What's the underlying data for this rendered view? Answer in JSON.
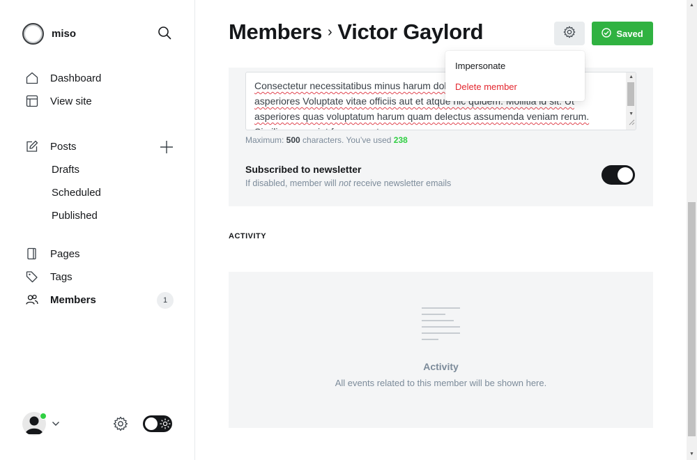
{
  "brand": {
    "name": "miso",
    "logo_icon": "ring-logo"
  },
  "sidebar": {
    "nav": [
      {
        "label": "Dashboard",
        "icon": "home-icon"
      },
      {
        "label": "View site",
        "icon": "layout-icon"
      }
    ],
    "posts": {
      "label": "Posts",
      "icon": "edit-icon",
      "sub": [
        "Drafts",
        "Scheduled",
        "Published"
      ]
    },
    "lower_nav": [
      {
        "label": "Pages",
        "icon": "page-icon"
      },
      {
        "label": "Tags",
        "icon": "tag-icon"
      },
      {
        "label": "Members",
        "icon": "members-icon",
        "badge": "1",
        "active": true
      }
    ],
    "theme_toggle": {
      "dark_mode": true
    }
  },
  "header": {
    "breadcrumb_parent": "Members",
    "breadcrumb_separator": "›",
    "member_name": "Victor Gaylord",
    "save_label": "Saved",
    "colors": {
      "saved": "#30b241"
    }
  },
  "dropdown": {
    "impersonate": "Impersonate",
    "delete": "Delete member",
    "colors": {
      "delete": "#e3252d"
    }
  },
  "form": {
    "note_text": "Consectetur necessitatibus minus harum dolorum quidem. Mollitia id sit. Ut asperiores Voluptate vitae officiis aut et atque hic quidem. Mollitia id sit. Ut asperiores quas voluptatum harum quam delectus assumenda veniam rerum. Similique eveniet facere sunt.",
    "hint_prefix": "Maximum: ",
    "hint_max": "500",
    "hint_middle": " characters. You’ve used ",
    "hint_used": "238",
    "newsletter_title": "Subscribed to newsletter",
    "newsletter_desc_before": "If disabled, member will ",
    "newsletter_desc_em": "not",
    "newsletter_desc_after": " receive newsletter emails",
    "newsletter_enabled": true
  },
  "activity": {
    "heading": "ACTIVITY",
    "empty_title": "Activity",
    "empty_desc": "All events related to this member will be shown here."
  }
}
